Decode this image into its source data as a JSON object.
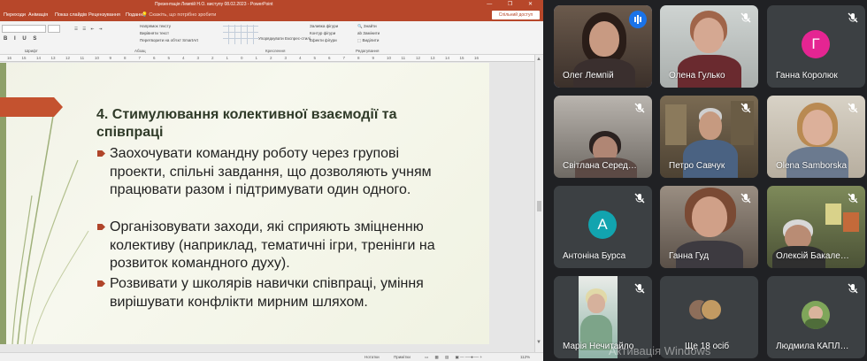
{
  "powerpoint": {
    "window_title": "Презентація Лемпій Н.О. виступу 08.02.2023 - PowerPoint",
    "tabs": [
      "Переходи",
      "Анімація",
      "Показ слайдів",
      "Рецензування",
      "Подання"
    ],
    "search_placeholder": "Скажіть, що потрібно зробити",
    "share_label": "Спільний доступ",
    "ribbon": {
      "find": "Знайти",
      "replace": "Замінити",
      "select": "Виділити",
      "arrange": "Упорядкувати",
      "quick_styles": "Експрес-стилі",
      "shape_fill": "Заливка фігури",
      "shape_outline": "Контур фігури",
      "shape_effects": "Ефекти фігури",
      "text_direction": "Напрямок тексту",
      "align_text": "Вирівняти текст",
      "smartart": "Перетворити на об'єкт SmartArt",
      "groups": [
        "Шрифт",
        "Абзац",
        "Креслення",
        "Редагування"
      ]
    },
    "ruler_ticks": [
      "16",
      "15",
      "14",
      "13",
      "12",
      "11",
      "10",
      "9",
      "8",
      "7",
      "6",
      "5",
      "4",
      "3",
      "2",
      "1",
      "0",
      "1",
      "2",
      "3",
      "4",
      "5",
      "6",
      "7",
      "8",
      "9",
      "10",
      "11",
      "12",
      "13",
      "14",
      "15",
      "16"
    ],
    "status": {
      "notes": "Нотатки",
      "comments": "Примітки",
      "zoom": "112%"
    },
    "slide": {
      "heading": "4. Стимулювання колективної взаємодії та співпраці",
      "bullets": [
        "Заохочувати командну роботу через групові проекти, спільні завдання, що дозволяють учням працювати разом і підтримувати один одного.",
        "Організовувати заходи, які сприяють зміцненню колективу (наприклад, тематичні ігри, тренінги на розвиток командного духу).",
        "Розвивати у школярів навички співпраці, уміння вирішувати конфлікти мирним шляхом."
      ]
    }
  },
  "meet": {
    "participants": [
      {
        "name": "Олег Лемпій",
        "muted": false,
        "speaking": true
      },
      {
        "name": "Олена Гулько",
        "muted": true
      },
      {
        "name": "Ганна Королюк",
        "muted": true,
        "initial": "Г",
        "avatar_color": "#e52592"
      },
      {
        "name": "Світлана Серед…",
        "muted": true
      },
      {
        "name": "Петро Савчук",
        "muted": true
      },
      {
        "name": "Olena Samborska",
        "muted": true
      },
      {
        "name": "Антоніна Бурса",
        "muted": true,
        "initial": "А",
        "avatar_color": "#12a4af"
      },
      {
        "name": "Ганна Гуд",
        "muted": true
      },
      {
        "name": "Олексій Бакале…",
        "muted": true
      },
      {
        "name": "Марія Нечитайло",
        "muted": true
      },
      {
        "name": "Ще 18 осіб",
        "muted": false
      },
      {
        "name": "Людмила КАПЛ…",
        "muted": true
      }
    ],
    "colors": {
      "tile_bg": "#3c4043",
      "page_bg": "#202124",
      "active_outline": "#8ab4f8",
      "speak_blue": "#1a73e8"
    }
  },
  "watermark": "Активація Windows"
}
